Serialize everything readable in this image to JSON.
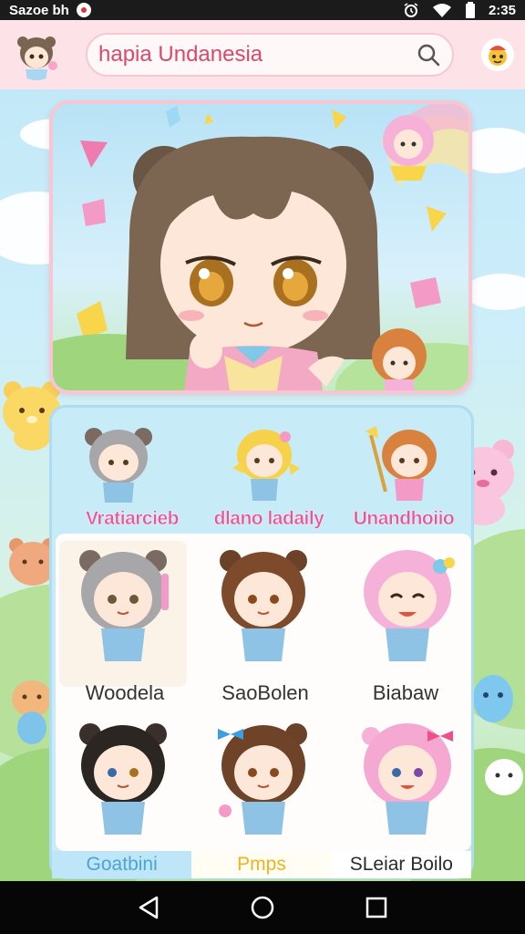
{
  "status_bar": {
    "carrier": "Sazoe bh",
    "time": "2:35"
  },
  "header": {
    "search_text": "hapia Undanesia"
  },
  "categories": [
    {
      "label": "Vratiarcieb"
    },
    {
      "label": "dlano ladaily"
    },
    {
      "label": "Unandhoiio"
    }
  ],
  "grid": [
    {
      "label": "Woodela"
    },
    {
      "label": "SaoBolen"
    },
    {
      "label": "Biabaw"
    },
    {
      "label": "",
      "hair": "#2c2622"
    },
    {
      "label": "",
      "hair": "#6e4327"
    },
    {
      "label": "",
      "hair": "#f5a9d2"
    }
  ],
  "tabs": [
    {
      "label": "Goatbini"
    },
    {
      "label": "Pmps"
    },
    {
      "label": "SLeiar Boilo"
    }
  ],
  "colors": {
    "header_bg": "#fde3e8",
    "accent_pink": "#e4589a",
    "panel_blue": "#c7ebf7"
  }
}
